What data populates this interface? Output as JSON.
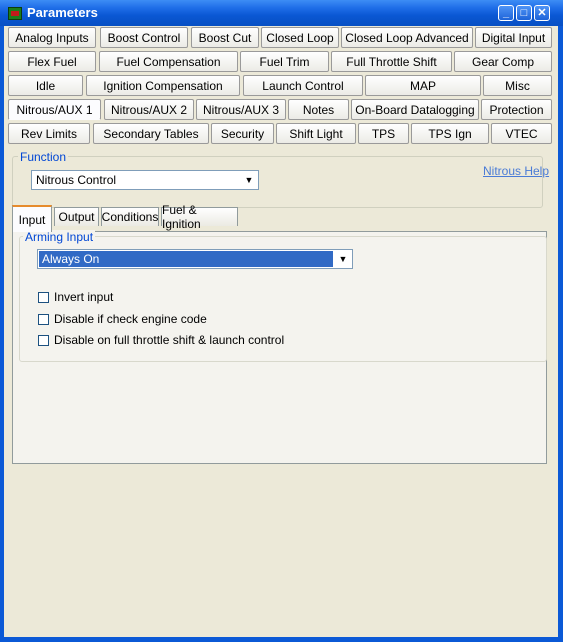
{
  "window": {
    "title": "Parameters"
  },
  "title_buttons": {
    "minimize": "_",
    "maximize": "□",
    "close": "✕"
  },
  "tabs": {
    "row1": [
      "Analog Inputs",
      "Boost Control",
      "Boost Cut",
      "Closed Loop",
      "Closed Loop Advanced",
      "Digital Input"
    ],
    "row2": [
      "Flex Fuel",
      "Fuel Compensation",
      "Fuel Trim",
      "Full Throttle Shift",
      "Gear Comp"
    ],
    "row3": [
      "Idle",
      "Ignition Compensation",
      "Launch Control",
      "MAP",
      "Misc"
    ],
    "row4": [
      "Nitrous/AUX 1",
      "Nitrous/AUX 2",
      "Nitrous/AUX 3",
      "Notes",
      "On-Board Datalogging",
      "Protection"
    ],
    "row5": [
      "Rev Limits",
      "Secondary Tables",
      "Security",
      "Shift Light",
      "TPS",
      "TPS Ign",
      "VTEC"
    ],
    "active": "Nitrous/AUX 1"
  },
  "function": {
    "legend": "Function",
    "selected": "Nitrous Control",
    "help_link": "Nitrous Help"
  },
  "inner_tabs": {
    "items": [
      "Input",
      "Output",
      "Conditions",
      "Fuel & Ignition"
    ],
    "active": "Input"
  },
  "arming": {
    "legend": "Arming Input",
    "selected": "Always On",
    "checkboxes": [
      {
        "label": "Invert input",
        "checked": false
      },
      {
        "label": "Disable if check engine code",
        "checked": false
      },
      {
        "label": "Disable on full throttle shift & launch control",
        "checked": false
      }
    ]
  },
  "colors": {
    "titlebar": "#0a57d3",
    "legend": "#0046d5",
    "selection": "#316ac5",
    "link": "#4a7bd6"
  }
}
